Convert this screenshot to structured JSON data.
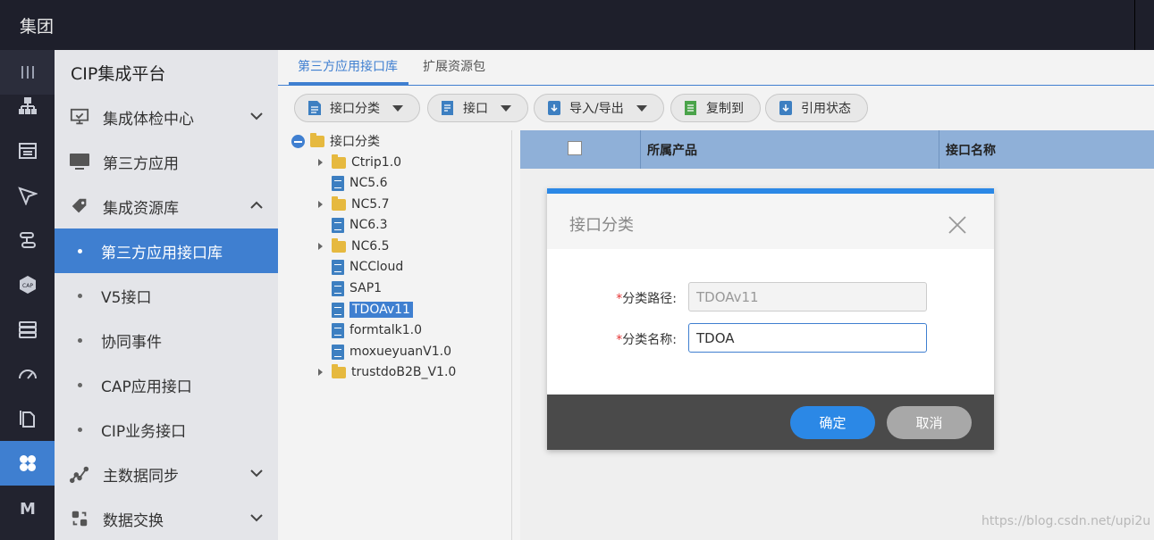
{
  "topbar": {
    "title": "集团"
  },
  "rail": {
    "icons": [
      "menu-icon",
      "org-tree-icon",
      "table-icon",
      "send-icon",
      "integration-icon",
      "cap-icon",
      "database-icon",
      "gauge-icon",
      "file-copy-icon",
      "app-grid-icon",
      "m-logo-icon"
    ],
    "cap_text": "CAP",
    "m_text": "M"
  },
  "nav": {
    "header": "CIP集成平台",
    "items": {
      "health": "集成体检中心",
      "thirdparty": "第三方应用",
      "resources": "集成资源库",
      "masterdata": "主数据同步",
      "exchange": "数据交换"
    },
    "subitems": {
      "s0": "第三方应用接口库",
      "s1": "V5接口",
      "s2": "协同事件",
      "s3": "CAP应用接口",
      "s4": "CIP业务接口"
    }
  },
  "tabs": {
    "t0": "第三方应用接口库",
    "t1": "扩展资源包"
  },
  "toolbar": {
    "category": "接口分类",
    "interface": "接口",
    "importexport": "导入/导出",
    "copyto": "复制到",
    "refstatus": "引用状态"
  },
  "tree": {
    "root": "接口分类",
    "n0": "Ctrip1.0",
    "n1": "NC5.6",
    "n2": "NC5.7",
    "n3": "NC6.3",
    "n4": "NC6.5",
    "n5": "NCCloud",
    "n6": "SAP1",
    "n7": "TDOAv11",
    "n8": "formtalk1.0",
    "n9": "moxueyuanV1.0",
    "n10": "trustdoB2B_V1.0"
  },
  "grid": {
    "col_product": "所属产品",
    "col_name": "接口名称"
  },
  "modal": {
    "title": "接口分类",
    "required_mark": "*",
    "path_label": "分类路径:",
    "path_value": "TDOAv11",
    "name_label": "分类名称:",
    "name_value": "TDOA",
    "ok": "确定",
    "cancel": "取消"
  },
  "watermark": "https://blog.csdn.net/upi2u",
  "colors": {
    "accent": "#3f7fd0",
    "dark_bg": "#1e1f2b",
    "modal_accent": "#2b88e6"
  }
}
